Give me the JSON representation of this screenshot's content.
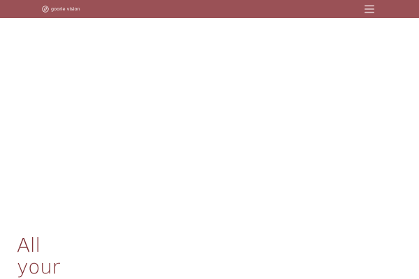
{
  "header": {
    "brand": "goorie vision",
    "logo_icon": "swirl-logo-icon",
    "menu_icon": "hamburger-menu-icon",
    "background_color": "#9a5156"
  },
  "hero": {
    "line1": "All",
    "line2": "your",
    "text_color": "#7c2c30"
  }
}
